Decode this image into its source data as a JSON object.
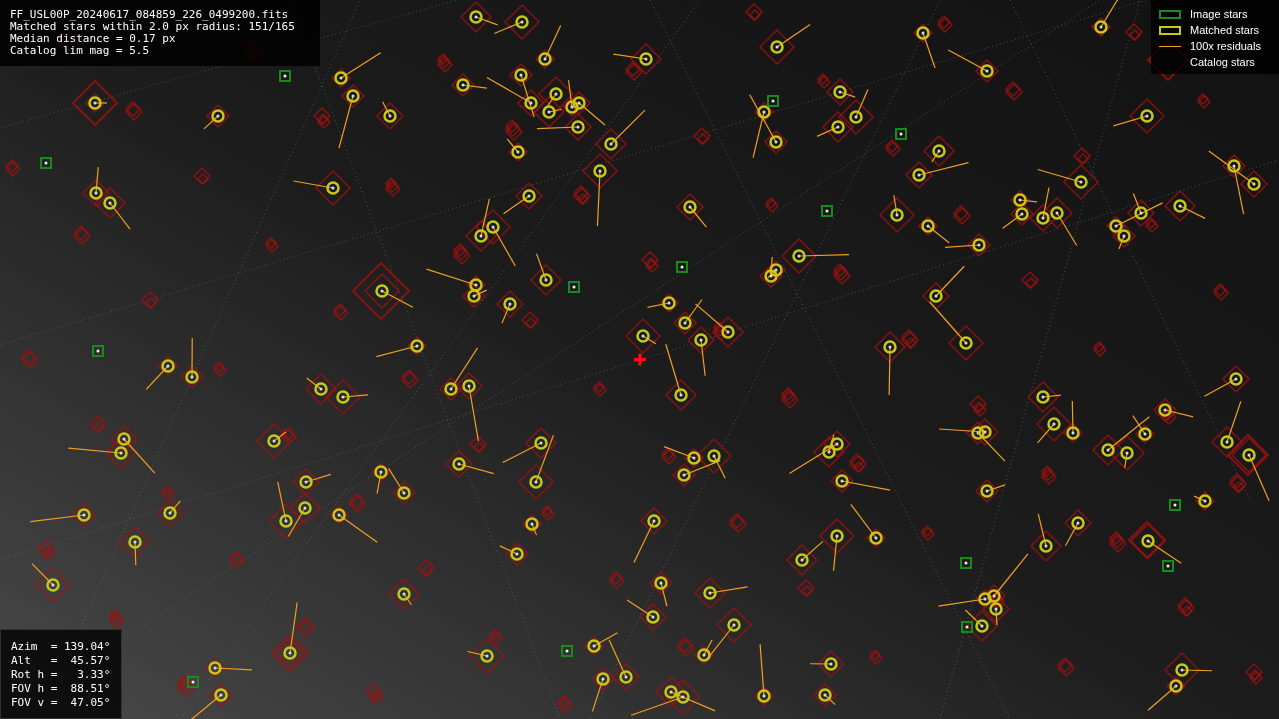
{
  "header": {
    "lines": [
      "FF_USL00P_20240617_084859_226_0499200.fits",
      "Matched stars within 2.0 px radius: 151/165",
      "Median distance = 0.17 px",
      "Catalog lim mag = 5.5"
    ]
  },
  "legend": [
    {
      "kind": "image",
      "label": "Image stars"
    },
    {
      "kind": "matched",
      "label": "Matched stars"
    },
    {
      "kind": "residual",
      "label": "100x residuals"
    },
    {
      "kind": "catalog",
      "label": "Catalog stars"
    }
  ],
  "pointing": {
    "lines": [
      "Azim  = 139.04°",
      "Alt   =  45.57°",
      "Rot h =   3.33°",
      "FOV h =  88.51°",
      "FOV v =  47.05°"
    ]
  }
}
